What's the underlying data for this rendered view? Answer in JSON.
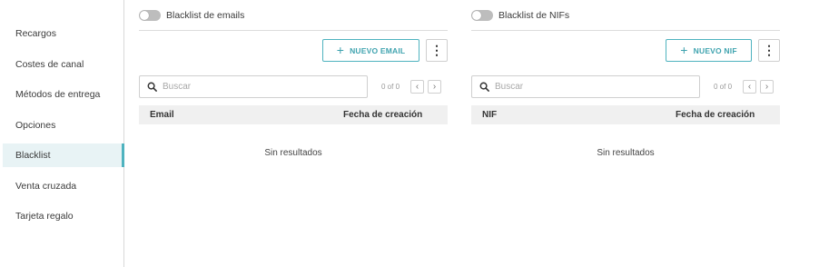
{
  "sidebar": {
    "items": [
      {
        "label": "Recargos"
      },
      {
        "label": "Costes de canal"
      },
      {
        "label": "Métodos de entrega"
      },
      {
        "label": "Opciones"
      },
      {
        "label": "Blacklist",
        "active": true
      },
      {
        "label": "Venta cruzada"
      },
      {
        "label": "Tarjeta regalo"
      }
    ]
  },
  "emails": {
    "toggle_label": "Blacklist de emails",
    "toggle_on": false,
    "new_button_label": "NUEVO EMAIL",
    "search_placeholder": "Buscar",
    "pager_count": "0 of 0",
    "columns": [
      "Email",
      "Fecha de creación"
    ],
    "empty_text": "Sin resultados"
  },
  "nifs": {
    "toggle_label": "Blacklist de NIFs",
    "toggle_on": false,
    "new_button_label": "NUEVO NIF",
    "search_placeholder": "Buscar",
    "pager_count": "0 of 0",
    "columns": [
      "NIF",
      "Fecha de creación"
    ],
    "empty_text": "Sin resultados"
  },
  "icons": {
    "plus": "plus-icon",
    "more": "more-vertical-icon",
    "search": "search-icon",
    "prev": "chevron-left-icon",
    "next": "chevron-right-icon"
  },
  "colors": {
    "accent": "#4fb3bf",
    "active_bg": "#e8f3f5",
    "table_header_bg": "#f0f0f0",
    "toggle_off": "#bdbdbd"
  }
}
